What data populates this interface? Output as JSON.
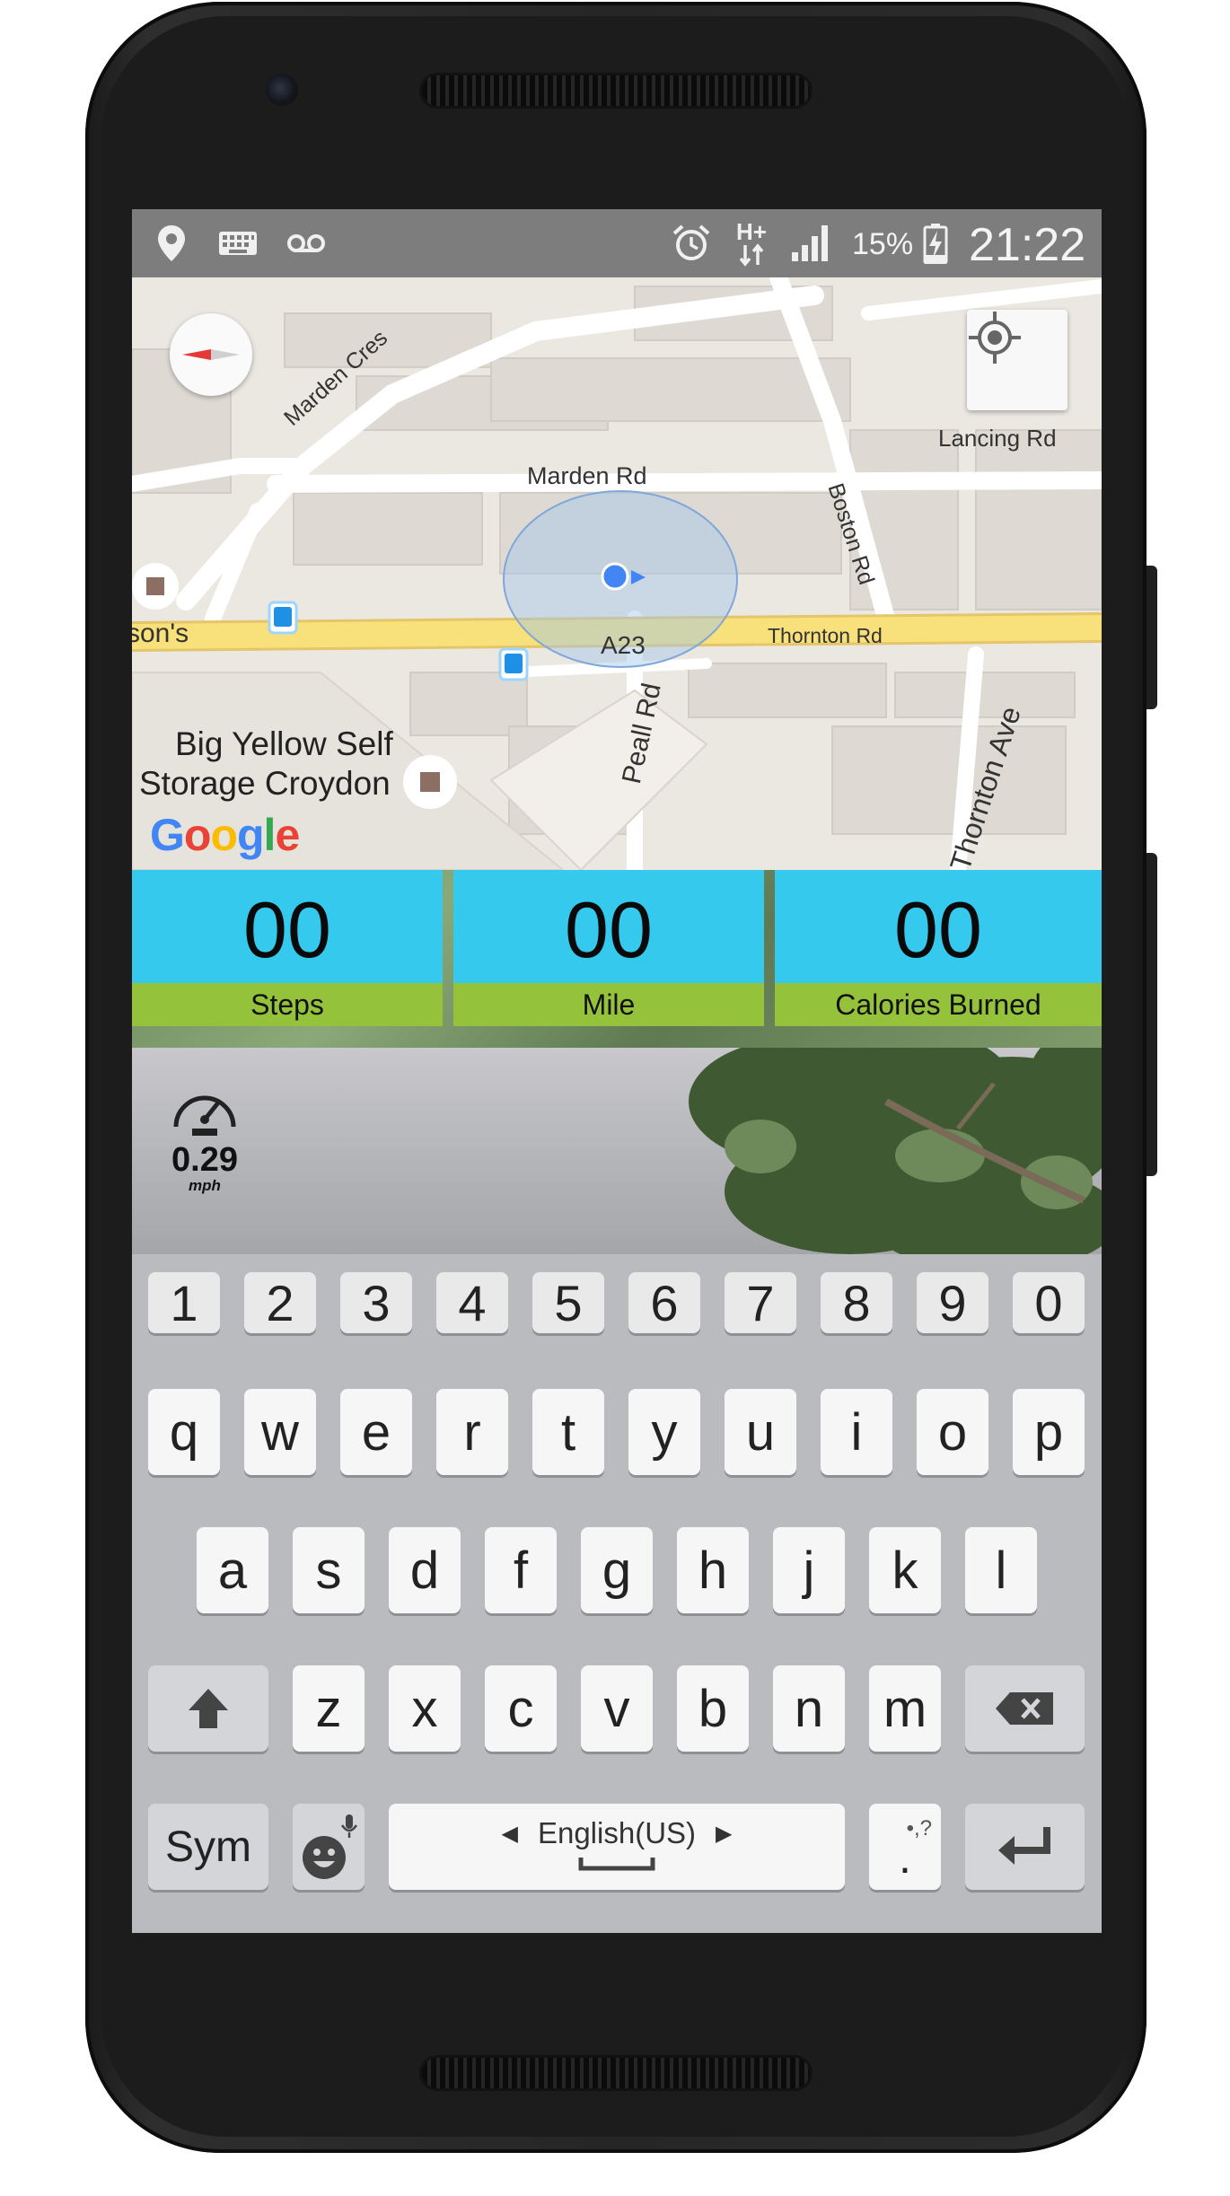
{
  "status_bar": {
    "left_icons": [
      "location-pin-icon",
      "keyboard-icon",
      "voicemail-icon"
    ],
    "right_icons": [
      "alarm-clock-icon",
      "network-hplus-icon",
      "signal-bars-icon",
      "battery-charging-icon"
    ],
    "network_type": "H+",
    "battery": "15%",
    "time": "21:22"
  },
  "map": {
    "streets": {
      "marden_cres": "Marden Cres",
      "marden_rd": "Marden Rd",
      "boston_rd": "Boston Rd",
      "lancing_rd": "Lancing Rd",
      "a23": "A23",
      "thornton_rd": "Thornton Rd",
      "peall_rd": "Peall Rd",
      "thornton_ave": "Thornton Ave",
      "clipped_left": "son's"
    },
    "poi": {
      "line1": "Big Yellow Self",
      "line2": "Storage Croydon"
    },
    "logo_text": "Google",
    "colors": {
      "major_road": "#f8e07a",
      "minor_road": "#ffffff",
      "land": "#ebe7e1",
      "location_dot": "#4285f4",
      "accuracy_circle": "#9fc5e8"
    }
  },
  "stats": [
    {
      "value": "00",
      "label": "Steps"
    },
    {
      "value": "00",
      "label": "Mile"
    },
    {
      "value": "00",
      "label": "Calories Burned"
    }
  ],
  "stats_colors": {
    "value_bg": "#35c9ee",
    "label_bg": "#95c23b"
  },
  "speed": {
    "value": "0.29",
    "unit": "mph",
    "icon": "speedometer-icon"
  },
  "keyboard": {
    "number_row": [
      "1",
      "2",
      "3",
      "4",
      "5",
      "6",
      "7",
      "8",
      "9",
      "0"
    ],
    "row1": [
      "q",
      "w",
      "e",
      "r",
      "t",
      "y",
      "u",
      "i",
      "o",
      "p"
    ],
    "row2": [
      "a",
      "s",
      "d",
      "f",
      "g",
      "h",
      "j",
      "k",
      "l"
    ],
    "row3": [
      "z",
      "x",
      "c",
      "v",
      "b",
      "n",
      "m"
    ],
    "sym_label": "Sym",
    "space_label": "English(US)",
    "period_label": ".",
    "punct_hint": "•,?",
    "icons": {
      "shift": "shift-arrow-icon",
      "backspace": "backspace-icon",
      "emoji": "emoji-mic-icon",
      "enter": "enter-icon"
    }
  }
}
